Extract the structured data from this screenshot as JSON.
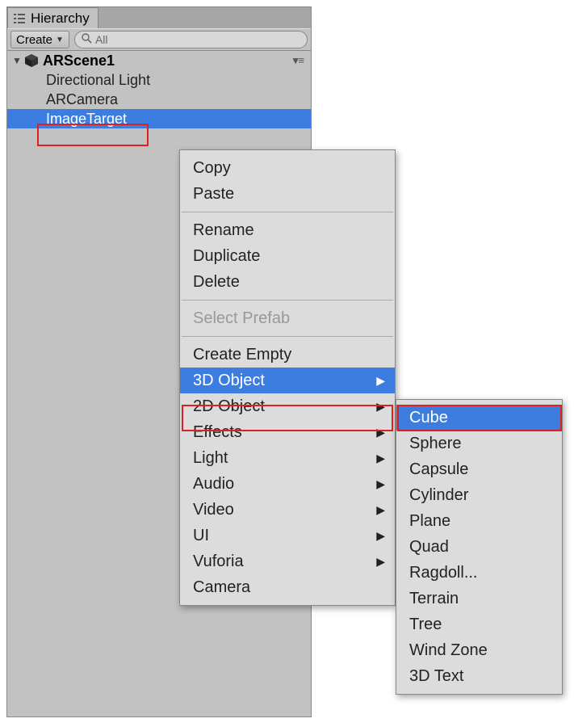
{
  "panel": {
    "tab_title": "Hierarchy",
    "create_label": "Create",
    "search_placeholder": "All"
  },
  "scene": {
    "name": "ARScene1",
    "items": [
      {
        "label": "Directional Light",
        "selected": false
      },
      {
        "label": "ARCamera",
        "selected": false
      },
      {
        "label": "ImageTarget",
        "selected": true
      }
    ]
  },
  "context_menu": {
    "groups": [
      [
        {
          "label": "Copy",
          "submenu": false,
          "disabled": false,
          "selected": false
        },
        {
          "label": "Paste",
          "submenu": false,
          "disabled": false,
          "selected": false
        }
      ],
      [
        {
          "label": "Rename",
          "submenu": false,
          "disabled": false,
          "selected": false
        },
        {
          "label": "Duplicate",
          "submenu": false,
          "disabled": false,
          "selected": false
        },
        {
          "label": "Delete",
          "submenu": false,
          "disabled": false,
          "selected": false
        }
      ],
      [
        {
          "label": "Select Prefab",
          "submenu": false,
          "disabled": true,
          "selected": false
        }
      ],
      [
        {
          "label": "Create Empty",
          "submenu": false,
          "disabled": false,
          "selected": false
        },
        {
          "label": "3D Object",
          "submenu": true,
          "disabled": false,
          "selected": true
        },
        {
          "label": "2D Object",
          "submenu": true,
          "disabled": false,
          "selected": false
        },
        {
          "label": "Effects",
          "submenu": true,
          "disabled": false,
          "selected": false
        },
        {
          "label": "Light",
          "submenu": true,
          "disabled": false,
          "selected": false
        },
        {
          "label": "Audio",
          "submenu": true,
          "disabled": false,
          "selected": false
        },
        {
          "label": "Video",
          "submenu": true,
          "disabled": false,
          "selected": false
        },
        {
          "label": "UI",
          "submenu": true,
          "disabled": false,
          "selected": false
        },
        {
          "label": "Vuforia",
          "submenu": true,
          "disabled": false,
          "selected": false
        },
        {
          "label": "Camera",
          "submenu": false,
          "disabled": false,
          "selected": false
        }
      ]
    ]
  },
  "submenu_3d": {
    "items": [
      {
        "label": "Cube",
        "selected": true
      },
      {
        "label": "Sphere",
        "selected": false
      },
      {
        "label": "Capsule",
        "selected": false
      },
      {
        "label": "Cylinder",
        "selected": false
      },
      {
        "label": "Plane",
        "selected": false
      },
      {
        "label": "Quad",
        "selected": false
      },
      {
        "label": "Ragdoll...",
        "selected": false
      },
      {
        "label": "Terrain",
        "selected": false
      },
      {
        "label": "Tree",
        "selected": false
      },
      {
        "label": "Wind Zone",
        "selected": false
      },
      {
        "label": "3D Text",
        "selected": false
      }
    ]
  }
}
